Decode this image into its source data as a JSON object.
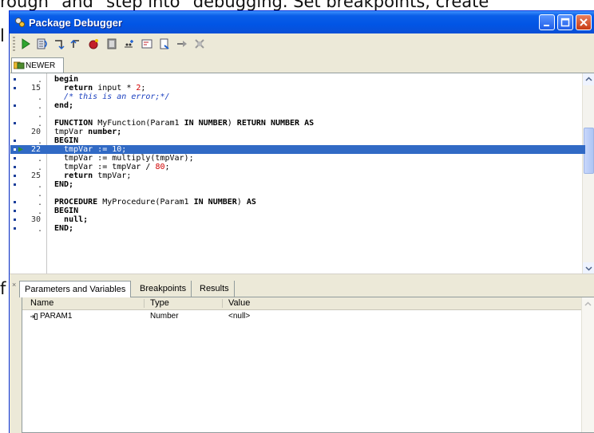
{
  "background": {
    "top_text": "rough\" and \"step into\" debugging. Set breakpoints, create",
    "left_line_1": "l",
    "left_line_2": "f"
  },
  "window": {
    "title": "Package Debugger",
    "title_bar_color": "#0155e5"
  },
  "toolbar": {
    "icons": [
      "run-icon",
      "step-over-icon",
      "step-into-icon",
      "step-out-icon",
      "breakpoint-icon",
      "pause-icon",
      "watch-icon",
      "evaluate-icon",
      "data-icon",
      "abort-icon",
      "terminate-icon"
    ]
  },
  "editor": {
    "tab_label": "NEWER",
    "lines": [
      {
        "num": "",
        "dot": true,
        "parts": [
          {
            "t": "begin",
            "c": "kw"
          }
        ]
      },
      {
        "num": "15",
        "dot": true,
        "parts": [
          {
            "t": "  "
          },
          {
            "t": "return",
            "c": "kw"
          },
          {
            "t": " input * "
          },
          {
            "t": "2",
            "c": "num"
          },
          {
            "t": ";"
          }
        ]
      },
      {
        "num": "",
        "dot": false,
        "parts": [
          {
            "t": "  "
          },
          {
            "t": "/* this is an error;*/",
            "c": "cmt"
          }
        ]
      },
      {
        "num": "",
        "dot": true,
        "parts": [
          {
            "t": "end;",
            "c": "kw"
          }
        ]
      },
      {
        "num": "",
        "dot": false,
        "parts": [
          {
            "t": ""
          }
        ]
      },
      {
        "num": "",
        "dot": true,
        "parts": [
          {
            "t": "FUNCTION",
            "c": "kw"
          },
          {
            "t": " MyFunction(Param1 "
          },
          {
            "t": "IN NUMBER",
            "c": "kw"
          },
          {
            "t": ") "
          },
          {
            "t": "RETURN NUMBER AS",
            "c": "kw"
          }
        ]
      },
      {
        "num": "20",
        "dot": false,
        "parts": [
          {
            "t": "tmpVar "
          },
          {
            "t": "number;",
            "c": "kw"
          }
        ]
      },
      {
        "num": "",
        "dot": true,
        "parts": [
          {
            "t": "BEGIN",
            "c": "kw"
          }
        ]
      },
      {
        "num": "22",
        "dot": true,
        "arrow": true,
        "hl": true,
        "parts": [
          {
            "t": "  tmpVar := 10;"
          }
        ]
      },
      {
        "num": "",
        "dot": true,
        "parts": [
          {
            "t": "  tmpVar := multiply(tmpVar);"
          }
        ]
      },
      {
        "num": "",
        "dot": true,
        "parts": [
          {
            "t": "  tmpVar := tmpVar / "
          },
          {
            "t": "80",
            "c": "num"
          },
          {
            "t": ";"
          }
        ]
      },
      {
        "num": "25",
        "dot": true,
        "parts": [
          {
            "t": "  "
          },
          {
            "t": "return",
            "c": "kw"
          },
          {
            "t": " tmpVar;"
          }
        ]
      },
      {
        "num": "",
        "dot": true,
        "parts": [
          {
            "t": "END;",
            "c": "kw"
          }
        ]
      },
      {
        "num": "",
        "dot": false,
        "parts": [
          {
            "t": ""
          }
        ]
      },
      {
        "num": "",
        "dot": true,
        "parts": [
          {
            "t": "PROCEDURE",
            "c": "kw"
          },
          {
            "t": " MyProcedure(Param1 "
          },
          {
            "t": "IN NUMBER",
            "c": "kw"
          },
          {
            "t": ") "
          },
          {
            "t": "AS",
            "c": "kw"
          }
        ]
      },
      {
        "num": "",
        "dot": true,
        "parts": [
          {
            "t": "BEGIN",
            "c": "kw"
          }
        ]
      },
      {
        "num": "30",
        "dot": true,
        "parts": [
          {
            "t": "  "
          },
          {
            "t": "null;",
            "c": "kw"
          }
        ]
      },
      {
        "num": "",
        "dot": true,
        "parts": [
          {
            "t": "END;",
            "c": "kw"
          }
        ]
      }
    ],
    "highlight_color": "#316ac5"
  },
  "bottom_panel": {
    "tabs": [
      "Parameters and Variables",
      "Breakpoints",
      "Results"
    ],
    "active_tab": 0,
    "columns": [
      "Name",
      "Type",
      "Value"
    ],
    "rows": [
      {
        "name": "PARAM1",
        "type": "Number",
        "value": "<null>"
      }
    ]
  }
}
